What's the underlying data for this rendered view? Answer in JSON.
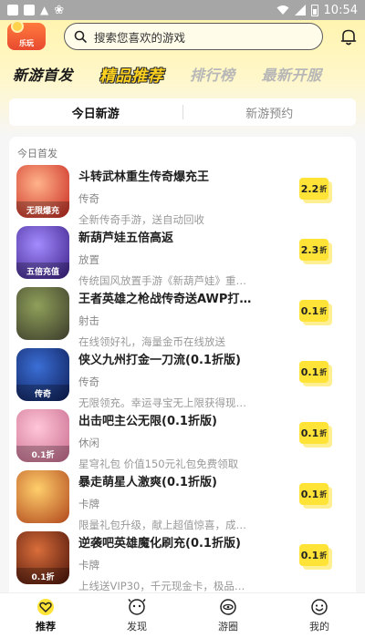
{
  "status_bar": {
    "time": "10:54"
  },
  "header": {
    "logo_text": "乐玩",
    "search_placeholder": "搜索您喜欢的游戏"
  },
  "category_tabs": [
    "新游首发",
    "精品推荐",
    "排行榜",
    "最新开服"
  ],
  "segment": [
    "今日新游",
    "新游预约"
  ],
  "section_label": "今日首发",
  "games": [
    {
      "name": "斗转武林重生传奇爆充王",
      "tag": "传奇",
      "desc": "全新传奇手游，送自动回收",
      "discount": "2.2",
      "unit": "折",
      "icon_text": "无限爆充",
      "icon_colors": [
        "#ffb38a",
        "#c8261e"
      ]
    },
    {
      "name": "新葫芦娃五倍高返",
      "tag": "放置",
      "desc": "传统国风放置手游《新葫芦娃》重…",
      "discount": "2.3",
      "unit": "折",
      "icon_text": "五倍充值",
      "icon_colors": [
        "#a48cff",
        "#3a1e86"
      ]
    },
    {
      "name": "王者英雄之枪战传奇送AWP打…",
      "tag": "射击",
      "desc": "在线领好礼，海量金币在线放送",
      "discount": "0.1",
      "unit": "折",
      "icon_text": "",
      "icon_colors": [
        "#8fa05a",
        "#3a3a2a"
      ]
    },
    {
      "name": "侠义九州打金一刀流(0.1折版)",
      "tag": "传奇",
      "desc": "无限领充。幸运寻宝无上限获得现…",
      "discount": "0.1",
      "unit": "折",
      "icon_text": "传奇",
      "icon_colors": [
        "#3b6fd6",
        "#0d1c55"
      ]
    },
    {
      "name": "出击吧主公无限(0.1折版)",
      "tag": "休闲",
      "desc": "星穹礼包 价值150元礼包免费领取",
      "discount": "0.1",
      "unit": "折",
      "icon_text": "0.1折",
      "icon_colors": [
        "#ffc6d8",
        "#c86a8c"
      ]
    },
    {
      "name": "暴走萌星人激爽(0.1折版)",
      "tag": "卡牌",
      "desc": "限量礼包升级，献上超值惊喜，成…",
      "discount": "0.1",
      "unit": "折",
      "icon_text": "",
      "icon_colors": [
        "#ffcf6b",
        "#b0461c"
      ]
    },
    {
      "name": "逆袭吧英雄魔化刷充(0.1折版)",
      "tag": "卡牌",
      "desc": "上线送VIP30，千元现金卡，极品…",
      "discount": "0.1",
      "unit": "折",
      "icon_text": "0.1折",
      "icon_colors": [
        "#d96e3b",
        "#4a1208"
      ]
    }
  ],
  "bottom_nav": [
    "推荐",
    "发现",
    "游圈",
    "我的"
  ]
}
